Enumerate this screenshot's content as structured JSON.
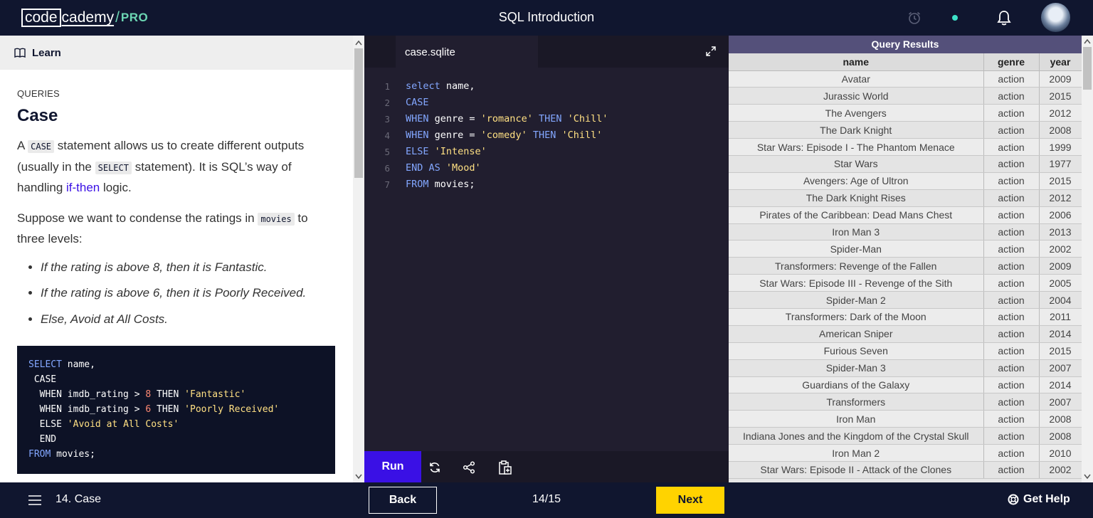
{
  "header": {
    "logo_code": "code",
    "logo_cademy": "cademy",
    "logo_slash": "/",
    "logo_pro": "PRO",
    "title": "SQL Introduction"
  },
  "learn": {
    "tab_label": "Learn",
    "section": "QUERIES",
    "heading": "Case",
    "p1_a": "A ",
    "p1_code1": "CASE",
    "p1_b": " statement allows us to create different outputs (usually in the ",
    "p1_code2": "SELECT",
    "p1_c": " statement). It is SQL’s way of handling ",
    "p1_link": "if-then",
    "p1_d": " logic.",
    "p2_a": "Suppose we want to condense the ratings in ",
    "p2_code": "movies",
    "p2_b": " to three levels:",
    "bullets": [
      "If the rating is above 8, then it is Fantastic.",
      "If the rating is above 6, then it is Poorly Received.",
      "Else, Avoid at All Costs."
    ],
    "code": {
      "l1_kw": "SELECT",
      "l1_rest": " name,",
      "l2": " CASE",
      "l3_a": "  WHEN imdb_rating > ",
      "l3_num": "8",
      "l3_b": " THEN ",
      "l3_str": "'Fantastic'",
      "l4_a": "  WHEN imdb_rating > ",
      "l4_num": "6",
      "l4_b": " THEN ",
      "l4_str": "'Poorly Received'",
      "l5_a": "  ELSE ",
      "l5_str": "'Avoid at All Costs'",
      "l6": "  END",
      "l7_kw": "FROM",
      "l7_rest": " movies;"
    }
  },
  "editor": {
    "file_tab": "case.sqlite",
    "lines": [
      {
        "n": "1",
        "parts": [
          {
            "t": "select",
            "c": "kw"
          },
          {
            "t": " name,",
            "c": ""
          }
        ]
      },
      {
        "n": "2",
        "parts": [
          {
            "t": "CASE",
            "c": "kw"
          }
        ]
      },
      {
        "n": "3",
        "parts": [
          {
            "t": "WHEN",
            "c": "kw"
          },
          {
            "t": " genre = ",
            "c": ""
          },
          {
            "t": "'romance'",
            "c": "str"
          },
          {
            "t": " THEN ",
            "c": "kw"
          },
          {
            "t": "'Chill'",
            "c": "str"
          }
        ]
      },
      {
        "n": "4",
        "parts": [
          {
            "t": "WHEN",
            "c": "kw"
          },
          {
            "t": " genre = ",
            "c": ""
          },
          {
            "t": "'comedy'",
            "c": "str"
          },
          {
            "t": " THEN ",
            "c": "kw"
          },
          {
            "t": "'Chill'",
            "c": "str"
          }
        ]
      },
      {
        "n": "5",
        "parts": [
          {
            "t": "ELSE",
            "c": "kw"
          },
          {
            "t": " ",
            "c": ""
          },
          {
            "t": "'Intense'",
            "c": "str"
          }
        ]
      },
      {
        "n": "6",
        "parts": [
          {
            "t": "END AS",
            "c": "kw"
          },
          {
            "t": " ",
            "c": ""
          },
          {
            "t": "'Mood'",
            "c": "str"
          }
        ]
      },
      {
        "n": "7",
        "parts": [
          {
            "t": "FROM",
            "c": "kw"
          },
          {
            "t": " movies;",
            "c": ""
          }
        ]
      }
    ],
    "run_label": "Run"
  },
  "results": {
    "title": "Query Results",
    "columns": [
      "name",
      "genre",
      "year"
    ],
    "rows": [
      [
        "Avatar",
        "action",
        "2009"
      ],
      [
        "Jurassic World",
        "action",
        "2015"
      ],
      [
        "The Avengers",
        "action",
        "2012"
      ],
      [
        "The Dark Knight",
        "action",
        "2008"
      ],
      [
        "Star Wars: Episode I - The Phantom Menace",
        "action",
        "1999"
      ],
      [
        "Star Wars",
        "action",
        "1977"
      ],
      [
        "Avengers: Age of Ultron",
        "action",
        "2015"
      ],
      [
        "The Dark Knight Rises",
        "action",
        "2012"
      ],
      [
        "Pirates of the Caribbean: Dead Mans Chest",
        "action",
        "2006"
      ],
      [
        "Iron Man 3",
        "action",
        "2013"
      ],
      [
        "Spider-Man",
        "action",
        "2002"
      ],
      [
        "Transformers: Revenge of the Fallen",
        "action",
        "2009"
      ],
      [
        "Star Wars: Episode III - Revenge of the Sith",
        "action",
        "2005"
      ],
      [
        "Spider-Man 2",
        "action",
        "2004"
      ],
      [
        "Transformers: Dark of the Moon",
        "action",
        "2011"
      ],
      [
        "American Sniper",
        "action",
        "2014"
      ],
      [
        "Furious Seven",
        "action",
        "2015"
      ],
      [
        "Spider-Man 3",
        "action",
        "2007"
      ],
      [
        "Guardians of the Galaxy",
        "action",
        "2014"
      ],
      [
        "Transformers",
        "action",
        "2007"
      ],
      [
        "Iron Man",
        "action",
        "2008"
      ],
      [
        "Indiana Jones and the Kingdom of the Crystal Skull",
        "action",
        "2008"
      ],
      [
        "Iron Man 2",
        "action",
        "2010"
      ],
      [
        "Star Wars: Episode II - Attack of the Clones",
        "action",
        "2002"
      ]
    ]
  },
  "footer": {
    "lesson": "14. Case",
    "back": "Back",
    "progress": "14/15",
    "next": "Next",
    "help": "Get Help"
  }
}
